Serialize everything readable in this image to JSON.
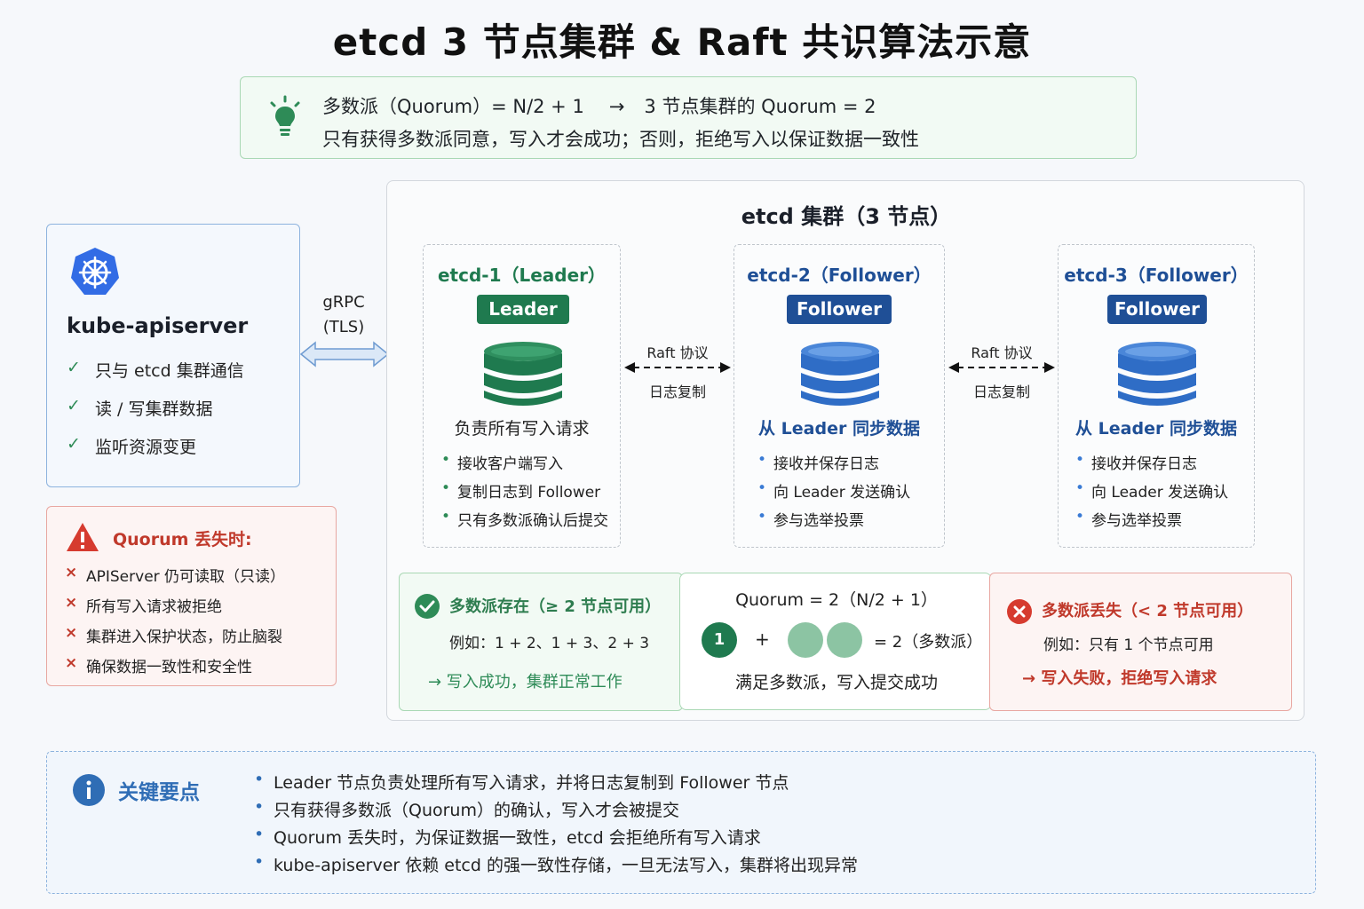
{
  "title": "etcd 3 节点集群 & Raft 共识算法示意",
  "quorum": {
    "formula": "多数派（Quorum）= N/2 + 1",
    "arrow": "→",
    "result": "3 节点集群的 Quorum = 2",
    "rule": "只有获得多数派同意，写入才会成功；否则，拒绝写入以保证数据一致性",
    "icon": "lightbulb-icon"
  },
  "apiserver": {
    "title": "kube-apiserver",
    "icon": "kubernetes-icon",
    "items": [
      "只与 etcd 集群通信",
      "读 / 写集群数据",
      "监听资源变更"
    ],
    "check": "✓"
  },
  "grpc": {
    "line1": "gRPC",
    "line2": "(TLS)"
  },
  "quorum_lost": {
    "title": "Quorum 丢失时:",
    "icon": "warning-icon",
    "mark": "×",
    "items": [
      "APIServer 仍可读取（只读）",
      "所有写入请求被拒绝",
      "集群进入保护状态，防止脑裂",
      "确保数据一致性和安全性"
    ]
  },
  "cluster": {
    "title": "etcd 集群（3 节点）",
    "nodes": [
      {
        "title": "etcd-1（Leader）",
        "badge": "Leader",
        "subtitle": "负责所有写入请求",
        "items": [
          "接收客户端写入",
          "复制日志到 Follower",
          "只有多数派确认后提交"
        ]
      },
      {
        "title": "etcd-2（Follower）",
        "badge": "Follower",
        "subtitle": "从 Leader 同步数据",
        "items": [
          "接收并保存日志",
          "向 Leader 发送确认",
          "参与选举投票"
        ]
      },
      {
        "title": "etcd-3（Follower）",
        "badge": "Follower",
        "subtitle": "从 Leader 同步数据",
        "items": [
          "接收并保存日志",
          "向 Leader 发送确认",
          "参与选举投票"
        ]
      }
    ],
    "links": [
      {
        "top": "Raft 协议",
        "bottom": "日志复制"
      },
      {
        "top": "Raft 协议",
        "bottom": "日志复制"
      }
    ],
    "bullet": "•"
  },
  "majority_ok": {
    "title": "多数派存在（≥ 2 节点可用）",
    "example": "例如：1 + 2、1 + 3、2 + 3",
    "result": "→ 写入成功，集群正常工作",
    "icon": "check-circle-icon"
  },
  "majority_mid": {
    "title": "Quorum = 2（N/2 + 1）",
    "one": "1",
    "plus": "+",
    "equals": "= 2（多数派）",
    "result": "满足多数派，写入提交成功"
  },
  "majority_lost": {
    "title": "多数派丢失（< 2 节点可用）",
    "example": "例如：只有 1 个节点可用",
    "result": "→ 写入失败，拒绝写入请求",
    "icon": "x-circle-icon"
  },
  "key_points": {
    "title": "关键要点",
    "icon": "info-icon",
    "items": [
      "Leader 节点负责处理所有写入请求，并将日志复制到 Follower 节点",
      "只有获得多数派（Quorum）的确认，写入才会被提交",
      "Quorum 丢失时，为保证数据一致性，etcd 会拒绝所有写入请求",
      "kube-apiserver 依赖 etcd 的强一致性存储，一旦无法写入，集群将出现异常"
    ]
  },
  "colors": {
    "leader_green": "#1f7a4f",
    "follower_blue": "#1f4f96",
    "node_blue_text": "#1f4f96",
    "ok_green": "#2e8b57",
    "lost_red": "#c0392b",
    "info_blue": "#2f6db5"
  }
}
